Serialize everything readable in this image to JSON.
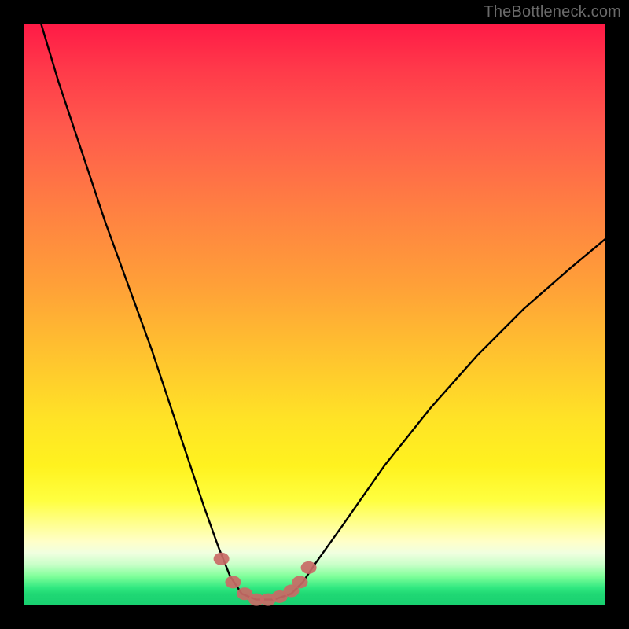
{
  "watermark": "TheBottleneck.com",
  "chart_data": {
    "type": "line",
    "title": "",
    "xlabel": "",
    "ylabel": "",
    "xlim": [
      0,
      100
    ],
    "ylim": [
      0,
      100
    ],
    "grid": false,
    "series": [
      {
        "name": "bottleneck-curve",
        "x": [
          3,
          6,
          10,
          14,
          18,
          22,
          25,
          28,
          31,
          33.5,
          35.5,
          37.5,
          40,
          43,
          46,
          48,
          50,
          55,
          62,
          70,
          78,
          86,
          94,
          100
        ],
        "values": [
          100,
          90,
          78,
          66,
          55,
          44,
          35,
          26,
          17,
          10,
          5,
          2,
          1,
          1,
          2,
          4,
          7,
          14,
          24,
          34,
          43,
          51,
          58,
          63
        ]
      }
    ],
    "floor_markers": {
      "name": "curve-floor-dots",
      "color": "#c96a66",
      "x": [
        34,
        36,
        38,
        40,
        42,
        44,
        46,
        47.5,
        49
      ],
      "values": [
        8,
        4,
        2,
        1,
        1,
        1.5,
        2.5,
        4,
        6.5
      ]
    }
  }
}
